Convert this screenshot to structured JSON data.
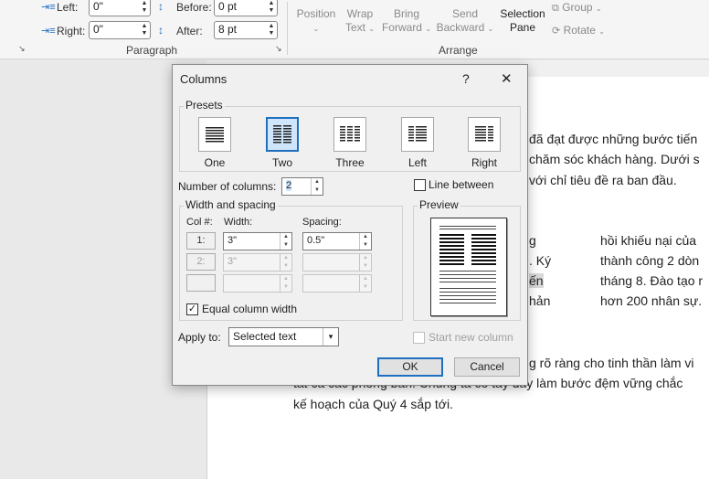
{
  "ribbon": {
    "indent": {
      "left_label": "Left:",
      "left_value": "0\"",
      "right_label": "Right:",
      "right_value": "0\""
    },
    "spacing": {
      "before_label": "Before:",
      "before_value": "0 pt",
      "after_label": "After:",
      "after_value": "8 pt"
    },
    "paragraph_group_label": "Paragraph",
    "arrange_group_label": "Arrange",
    "arrange": {
      "position": "Position",
      "wrap_text_1": "Wrap",
      "wrap_text_2": "Text",
      "bring_forward_1": "Bring",
      "bring_forward_2": "Forward",
      "send_backward_1": "Send",
      "send_backward_2": "Backward",
      "selection_pane_1": "Selection",
      "selection_pane_2": "Pane",
      "group": "Group",
      "rotate": "Rotate"
    }
  },
  "document": {
    "line1": "đã đạt được những bước tiến",
    "line2": "chăm sóc khách hàng. Dưới s",
    "line3": "với chỉ tiêu đề ra ban đầu.",
    "col_left": [
      "g",
      ". Ký",
      "ến",
      "hản"
    ],
    "col_right": [
      "hồi khiếu nại của",
      "thành công 2 dòn",
      "tháng 8. Đào tạo r",
      "hơn 200 nhân sự."
    ],
    "line4": "g rõ ràng cho tinh thần làm vi",
    "line5": "tất cả các phòng ban. Chúng ta có tấy đây làm bước đệm vững chắc",
    "line6": "kế hoạch của Quý 4 sắp tới."
  },
  "dialog": {
    "title": "Columns",
    "help": "?",
    "close": "✕",
    "presets_label": "Presets",
    "presets": [
      {
        "label": "One"
      },
      {
        "label": "Two"
      },
      {
        "label": "Three"
      },
      {
        "label": "Left"
      },
      {
        "label": "Right"
      }
    ],
    "selected_preset": "Two",
    "num_columns_label": "Number of columns:",
    "num_columns_value": "2",
    "line_between_label": "Line between",
    "width_spacing_label": "Width and spacing",
    "col_header": "Col #:",
    "width_header": "Width:",
    "spacing_header": "Spacing:",
    "rows": [
      {
        "col": "1:",
        "width": "3\"",
        "spacing": "0.5\""
      },
      {
        "col": "2:",
        "width": "3\"",
        "spacing": ""
      },
      {
        "col": "",
        "width": "",
        "spacing": ""
      }
    ],
    "equal_width_label": "Equal column width",
    "preview_label": "Preview",
    "apply_to_label": "Apply to:",
    "apply_to_value": "Selected text",
    "start_new_column_label": "Start new column",
    "ok_label": "OK",
    "cancel_label": "Cancel"
  },
  "colors": {
    "accent": "#1f6fbf",
    "dialog_bg": "#f0f0f0",
    "ribbon_bg": "#f5f5f5"
  }
}
